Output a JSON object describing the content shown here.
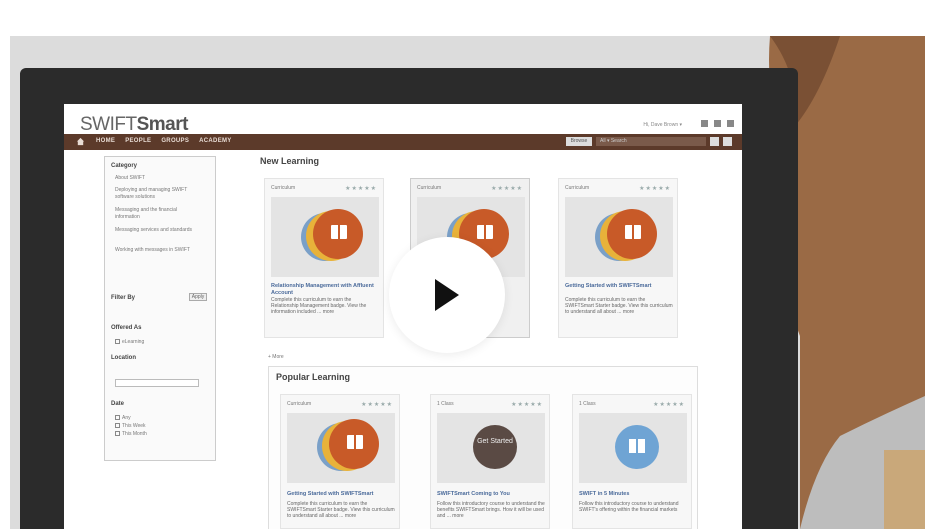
{
  "app": {
    "brand_prefix": "SWIFT",
    "brand_suffix": "Smart",
    "user_menu": "Hi, Dave Brown ▾"
  },
  "nav": {
    "items": [
      "HOME",
      "PEOPLE",
      "GROUPS",
      "ACADEMY"
    ],
    "browse_label": "Browse",
    "search_placeholder": "All ▾ Search"
  },
  "sidebar": {
    "category_heading": "Category",
    "categories": [
      "About SWIFT",
      "Deploying and managing SWIFT software solutions",
      "Messaging and the financial information",
      "Messaging services and standards",
      "Working with messages in SWIFT"
    ],
    "filter_heading": "Filter By",
    "apply_label": "Apply",
    "offered_heading": "Offered As",
    "offered_option": "eLearning",
    "location_heading": "Location",
    "date_heading": "Date",
    "date_options": [
      "Any",
      "This Week",
      "This Month"
    ]
  },
  "new_learning": {
    "title": "New Learning",
    "more_label": "+ More",
    "cards": [
      {
        "type": "Curriculum",
        "title": "Relationship Management with Affluent Account",
        "desc": "Complete this curriculum to earn the Relationship Management badge. View the information included ... more"
      },
      {
        "type": "Curriculum",
        "title": "",
        "desc": ""
      },
      {
        "type": "Curriculum",
        "title": "Getting Started with SWIFTSmart",
        "desc": "Complete this curriculum to earn the SWIFTSmart Starter badge. View this curriculum to understand all about ... more"
      }
    ]
  },
  "popular_learning": {
    "title": "Popular Learning",
    "cards": [
      {
        "type": "Curriculum",
        "title": "Getting Started with SWIFTSmart",
        "desc": "Complete this curriculum to earn the SWIFTSmart Starter badge. View this curriculum to understand all about ... more"
      },
      {
        "type": "1 Class",
        "badge_text": "Get Started",
        "title": "SWIFTSmart Coming to You",
        "desc": "Follow this introductory course to understand the benefits SWIFTSmart brings. How it will be used and ... more"
      },
      {
        "type": "1 Class",
        "title": "SWIFT in 5 Minutes",
        "desc": "Follow this introductory course to understand SWIFT's offering within the financial markets"
      }
    ]
  },
  "video": {
    "play_icon": "play-icon"
  },
  "colors": {
    "nav_bg": "#5c3a2a",
    "book_orange": "#c85a28",
    "ring_yellow": "#e8b23a",
    "ring_blue": "#7aa0c8"
  }
}
